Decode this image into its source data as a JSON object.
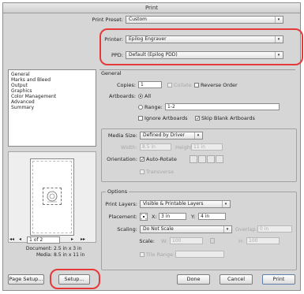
{
  "window": {
    "title": "Print"
  },
  "top": {
    "preset_label": "Print Preset:",
    "preset_value": "Custom",
    "printer_label": "Printer:",
    "printer_value": "Epilog Engraver",
    "ppd_label": "PPD:",
    "ppd_value": "Default (Epilog PDD)"
  },
  "sidebar": {
    "items": [
      "General",
      "Marks and Bleed",
      "Output",
      "Graphics",
      "Color Management",
      "Advanced",
      "Summary"
    ]
  },
  "preview": {
    "page_value": "1 of 2",
    "document_label": "Document:",
    "document_value": "2.5 in x 3 in",
    "media_label": "Media:",
    "media_value": "8.5 in x 11 in"
  },
  "general": {
    "title": "General",
    "copies_label": "Copies:",
    "copies_value": "1",
    "collate_label": "Collate",
    "reverse_label": "Reverse Order",
    "artboards_label": "Artboards:",
    "all_label": "All",
    "range_label": "Range:",
    "range_value": "1-2",
    "ignore_label": "Ignore Artboards",
    "skip_label": "Skip Blank Artboards"
  },
  "media": {
    "size_label": "Media Size:",
    "size_value": "Defined by Driver",
    "width_label": "Width:",
    "width_value": "8.5 in",
    "height_label": "Height:",
    "height_value": "11 in",
    "orientation_label": "Orientation:",
    "auto_rotate_label": "Auto-Rotate",
    "transverse_label": "Transverse"
  },
  "options": {
    "title": "Options",
    "print_layers_label": "Print Layers:",
    "print_layers_value": "Visible & Printable Layers",
    "placement_label": "Placement:",
    "x_label": "X:",
    "x_value": "3 in",
    "y_label": "Y:",
    "y_value": "4 in",
    "scaling_label": "Scaling:",
    "scaling_value": "Do Not Scale",
    "overlap_label": "Overlap:",
    "overlap_value": "0 in",
    "scale_label": "Scale:",
    "w_label": "W:",
    "w_value": "100",
    "h_label": "H:",
    "h_value": "100",
    "tile_range_label": "Tile Range:"
  },
  "buttons": {
    "page_setup": "Page Setup...",
    "setup": "Setup...",
    "done": "Done",
    "cancel": "Cancel",
    "print": "Print"
  },
  "annotation_color": "#e53a3a"
}
